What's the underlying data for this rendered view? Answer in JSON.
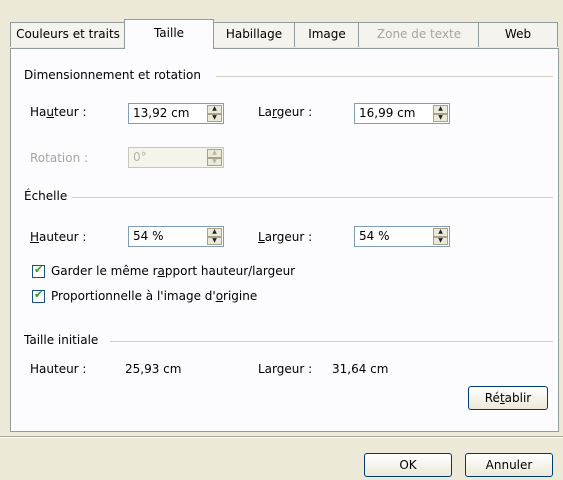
{
  "tabs": [
    {
      "label": "Couleurs et traits",
      "state": "normal"
    },
    {
      "label": "Taille",
      "state": "active"
    },
    {
      "label": "Habillage",
      "state": "normal"
    },
    {
      "label": "Image",
      "state": "normal"
    },
    {
      "label": "Zone de texte",
      "state": "disabled"
    },
    {
      "label": "Web",
      "state": "normal"
    }
  ],
  "dimension": {
    "title": "Dimensionnement et rotation",
    "hauteur_label_a": "Ha",
    "hauteur_label_u": "u",
    "hauteur_label_b": "teur :",
    "hauteur_value": "13,92 cm",
    "largeur_label_a": "La",
    "largeur_label_u": "r",
    "largeur_label_b": "geur :",
    "largeur_value": "16,99 cm",
    "rotation_label": "Rotation :",
    "rotation_value": "0°"
  },
  "echelle": {
    "title": "Échelle",
    "hauteur_label_u": "H",
    "hauteur_label_b": "auteur :",
    "hauteur_value": "54 %",
    "largeur_label_u": "L",
    "largeur_label_b": "argeur :",
    "largeur_value": "54 %",
    "check1_a": "Garder le même r",
    "check1_u": "a",
    "check1_b": "pport hauteur/largeur",
    "check1_checked": true,
    "check2_a": "Proportionnelle à l'image d'",
    "check2_u": "o",
    "check2_b": "rigine",
    "check2_checked": true
  },
  "initiale": {
    "title": "Taille initiale",
    "hauteur_label": "Hauteur :",
    "hauteur_value": "25,93 cm",
    "largeur_label": "Largeur :",
    "largeur_value": "31,64 cm",
    "reset_a": "Ré",
    "reset_u": "t",
    "reset_b": "ablir"
  },
  "footer": {
    "ok": "OK",
    "cancel": "Annuler"
  },
  "icons": {
    "spin_up": "▲",
    "spin_down": "▼"
  }
}
